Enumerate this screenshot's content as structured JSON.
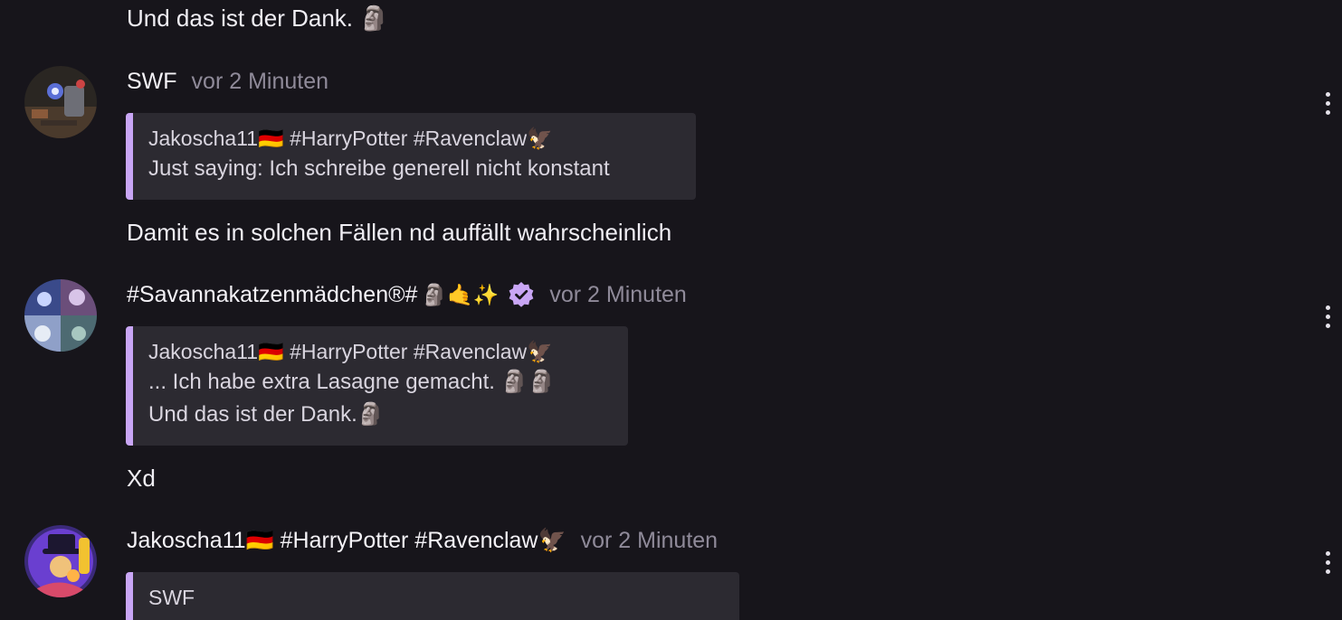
{
  "top_message": {
    "text": "Und das ist der Dank. 🗿"
  },
  "messages": [
    {
      "author": "SWF",
      "time": "vor 2 Minuten",
      "avatar_icon": "user-avatar-sci-fi",
      "quote": {
        "author": "Jakoscha11🇩🇪 #HarryPotter #Ravenclaw🦅",
        "lines": [
          "Just saying: Ich schreibe generell nicht konstant"
        ]
      },
      "text": "Damit es in solchen Fällen nd auffällt wahrscheinlich"
    },
    {
      "author": "#Savannakatzenmädchen®#",
      "author_emojis": "🗿🤙✨",
      "verified_icon": "verified-badge-icon",
      "time": "vor 2 Minuten",
      "avatar_icon": "user-avatar-collage",
      "quote": {
        "author": "Jakoscha11🇩🇪 #HarryPotter #Ravenclaw🦅",
        "lines": [
          "... Ich habe extra Lasagne gemacht. 🗿🗿",
          "Und das ist der Dank.🗿"
        ]
      },
      "text": "Xd"
    },
    {
      "author": "Jakoscha11🇩🇪 #HarryPotter #Ravenclaw🦅",
      "time": "vor 2 Minuten",
      "avatar_icon": "user-avatar-wizard",
      "quote": {
        "author": "SWF"
      }
    }
  ],
  "colors": {
    "background": "#17151b",
    "quote_background": "#2c2a31",
    "quote_accent": "#c9a6f5",
    "timestamp": "#8f8a99",
    "verified": "#c9a6f5"
  }
}
